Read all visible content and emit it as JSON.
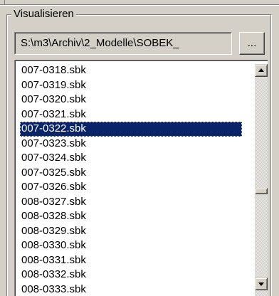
{
  "group": {
    "title": "Visualisieren"
  },
  "path_field": {
    "value": "S:\\m3\\Archiv\\2_Modelle\\SOBEK_"
  },
  "browse_button": {
    "label": "..."
  },
  "file_list": {
    "items": [
      "007-0318.sbk",
      "007-0319.sbk",
      "007-0320.sbk",
      "007-0321.sbk",
      "007-0322.sbk",
      "007-0323.sbk",
      "007-0324.sbk",
      "007-0325.sbk",
      "007-0326.sbk",
      "008-0327.sbk",
      "008-0328.sbk",
      "008-0329.sbk",
      "008-0330.sbk",
      "008-0331.sbk",
      "008-0332.sbk",
      "008-0333.sbk"
    ],
    "selected": "007-0322.sbk"
  },
  "scrollbar": {
    "up_icon": "arrow-up-icon",
    "down_icon": "arrow-down-icon"
  },
  "colors": {
    "window_bg": "#d4d0c8",
    "selection_bg": "#0a246a",
    "selection_fg": "#ffffff"
  }
}
